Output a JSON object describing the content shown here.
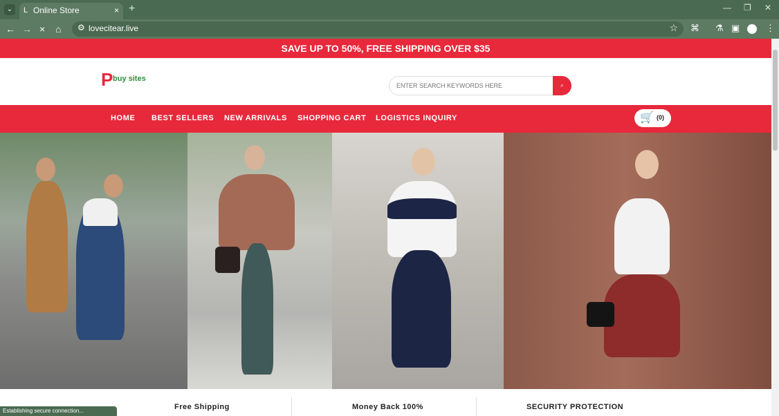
{
  "browser": {
    "tab_favicon": "L",
    "tab_title": "Online Store",
    "tab_close": "×",
    "new_tab": "+",
    "tab_dropdown": "⌄",
    "url": "lovecitear.live",
    "back_icon": "←",
    "forward_icon": "→",
    "stop_icon": "×",
    "home_icon": "⌂",
    "site_info_icon": "⚙",
    "bookmark_icon": "☆",
    "extensions_icon": "⌘",
    "labs_icon": "⚗",
    "sidepanel_icon": "▣",
    "menu_icon": "⋮",
    "minimize_icon": "—",
    "restore_icon": "❐",
    "close_window_icon": "✕"
  },
  "promo": {
    "text": "SAVE UP TO 50%, FREE SHIPPING OVER $35"
  },
  "header": {
    "logo_mark": "P",
    "logo_text": "buy sites",
    "search_placeholder": "ENTER SEARCH KEYWORDS HERE",
    "search_button": "⌕"
  },
  "nav": {
    "items": [
      {
        "label": "HOME"
      },
      {
        "label": "BEST SELLERS"
      },
      {
        "label": "NEW ARRIVALS"
      },
      {
        "label": "SHOPPING CART"
      },
      {
        "label": "LOGISTICS INQUIRY"
      }
    ],
    "cart_icon": "🛒",
    "cart_count": "(0)"
  },
  "features": [
    {
      "label": "Free Shipping"
    },
    {
      "label": "Money Back 100%"
    },
    {
      "label": "SECURITY PROTECTION"
    }
  ],
  "status_text": "Establishing secure connection...",
  "colors": {
    "brand_red": "#e8283b",
    "logo_green": "#2d8e3a",
    "chrome_green": "#4b6a52"
  }
}
